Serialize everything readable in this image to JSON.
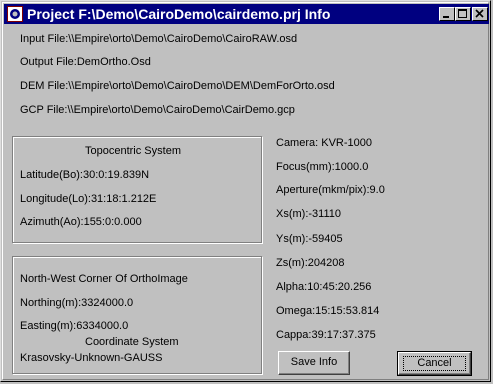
{
  "window": {
    "title": "Project F:\\Demo\\CairoDemo\\cairdemo.prj Info",
    "controls": {
      "minimize": "minimize",
      "maximize": "maximize",
      "close": "close"
    }
  },
  "files": {
    "input": "Input   File:\\\\Empire\\orto\\Demo\\CairoDemo\\CairoRAW.osd",
    "output": "Output File:DemOrtho.Osd",
    "dem": "DEM  File:\\\\Empire\\orto\\Demo\\CairoDemo\\DEM\\DemForOrto.osd",
    "gcp": "GCP   File:\\\\Empire\\orto\\Demo\\CairoDemo\\CairDemo.gcp"
  },
  "topocentric": {
    "heading": "Topocentric System",
    "latitude": "Latitude(Bo):30:0:19.839N",
    "longitude": "Longitude(Lo):31:18:1.212E",
    "azimuth": "Azimuth(Ao):155:0:0.000"
  },
  "orthoimage": {
    "heading": "North-West Corner Of OrthoImage",
    "northing": "Northing(m):3324000.0",
    "easting": "Easting(m):6334000.0",
    "coord_heading": "Coordinate System",
    "coord_value": "Krasovsky-Unknown-GAUSS"
  },
  "camera": {
    "camera": "Camera: KVR-1000",
    "focus": "Focus(mm):1000.0",
    "aperture": "Aperture(mkm/pix):9.0",
    "xs": "Xs(m):-31110",
    "ys": "Ys(m):-59405",
    "zs": "Zs(m):204208",
    "alpha": "Alpha:10:45:20.256",
    "omega": "Omega:15:15:53.814",
    "cappa": "Cappa:39:17:37.375"
  },
  "buttons": {
    "save": "Save Info",
    "cancel": "Cancel"
  },
  "colors": {
    "titlebar": "#000080",
    "face": "#c0c0c0"
  }
}
